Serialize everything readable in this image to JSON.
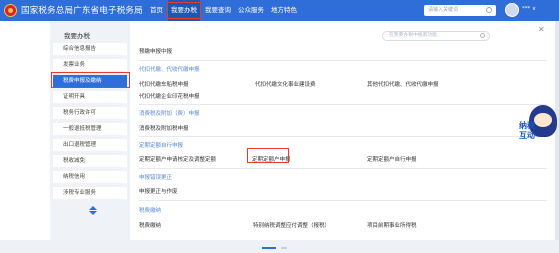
{
  "header": {
    "site_title": "国家税务总局广东省电子税务局",
    "nav": [
      {
        "label": "首页"
      },
      {
        "label": "我要办税"
      },
      {
        "label": "我要查询"
      },
      {
        "label": "公众服务"
      },
      {
        "label": "地方特色"
      }
    ],
    "active_nav": "我要办税",
    "search_placeholder": "请输入关键词",
    "user_name": "*** ∨"
  },
  "sidebar": {
    "title": "我要办税",
    "items": [
      {
        "label": "综合信息报告"
      },
      {
        "label": "发票业务"
      },
      {
        "label": "税费申报及缴纳"
      },
      {
        "label": "证明开具"
      },
      {
        "label": "税务行政许可"
      },
      {
        "label": "一般退抵税管理"
      },
      {
        "label": "出口退税管理"
      },
      {
        "label": "税收减免"
      },
      {
        "label": "纳税信用"
      },
      {
        "label": "涉税专业服务"
      }
    ],
    "active_item": "税费申报及缴纳"
  },
  "content": {
    "search_placeholder": "在我要办税中搜索功能",
    "first_link": "预缴申报中报",
    "sections": [
      {
        "title": "代扣代缴、代收代缴申报",
        "links": [
          "代扣代缴车船税申报",
          "代扣代缴文化事业建设费",
          "其他代扣代缴、代收代缴申报",
          "代扣代缴企业印花税申报"
        ]
      },
      {
        "title": "消费税及附加（费）申报",
        "links": [
          "消费税及附加税申报"
        ]
      },
      {
        "title": "定期定额自行申报",
        "links": [
          "定期定额户申请核定及调整定额",
          "定期定额户申报",
          "定期定额户自行申报"
        ]
      },
      {
        "title": "申报错误更正",
        "links": [
          "申报更正与作废"
        ]
      },
      {
        "title": "税费缴纳",
        "links": [
          "税费缴纳",
          "特别纳税调整应付调整（报税）",
          "项目前期事业所得税"
        ]
      }
    ],
    "highlighted_link": "定期定额户申报"
  },
  "mascot": {
    "text": "纳税\n互动"
  },
  "colors": {
    "primary": "#2f6ed8",
    "highlight": "#e33b2e",
    "category": "#5b87d6"
  }
}
